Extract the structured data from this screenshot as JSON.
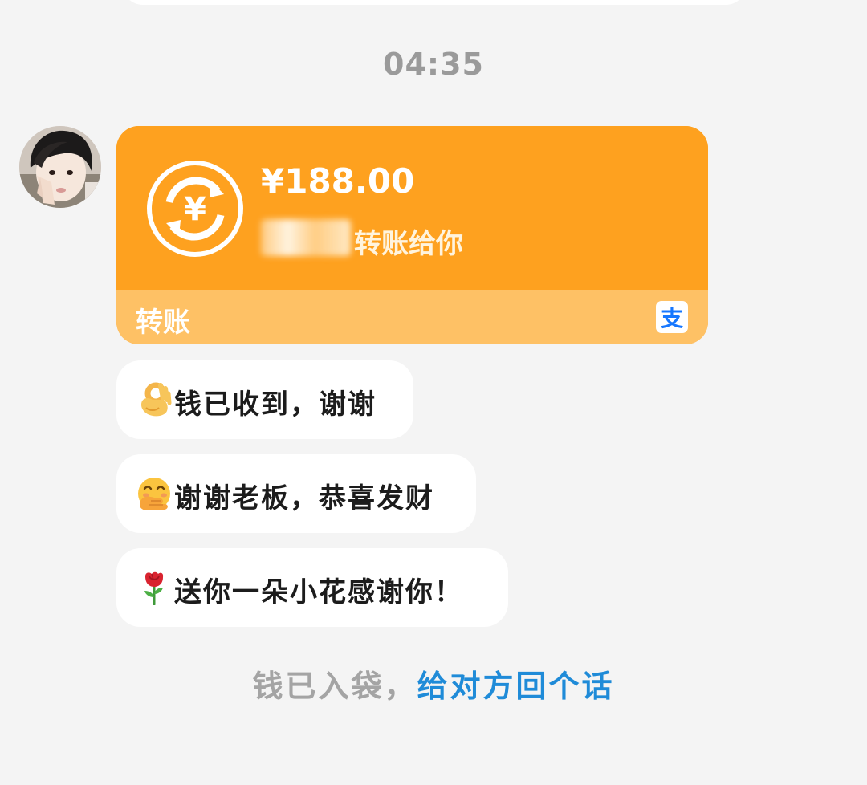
{
  "timestamp": "04:35",
  "transfer": {
    "amount": "¥188.00",
    "description": "转账给你",
    "label": "转账",
    "currency_symbol": "¥",
    "alipay_glyph": "支",
    "colors": {
      "card_top": "#fea11f",
      "card_bottom": "#fec165",
      "alipay_blue": "#1677ff"
    }
  },
  "messages": [
    {
      "emoji": "ok-hand-emoji",
      "text": "钱已收到，谢谢"
    },
    {
      "emoji": "hand-over-mouth-emoji",
      "text": "谢谢老板，恭喜发财"
    },
    {
      "emoji": "rose-emoji",
      "text": "送你一朵小花感谢你！"
    }
  ],
  "footer": {
    "static_text": "钱已入袋，",
    "link_text": "给对方回个话",
    "link_color": "#1f8bd8"
  }
}
